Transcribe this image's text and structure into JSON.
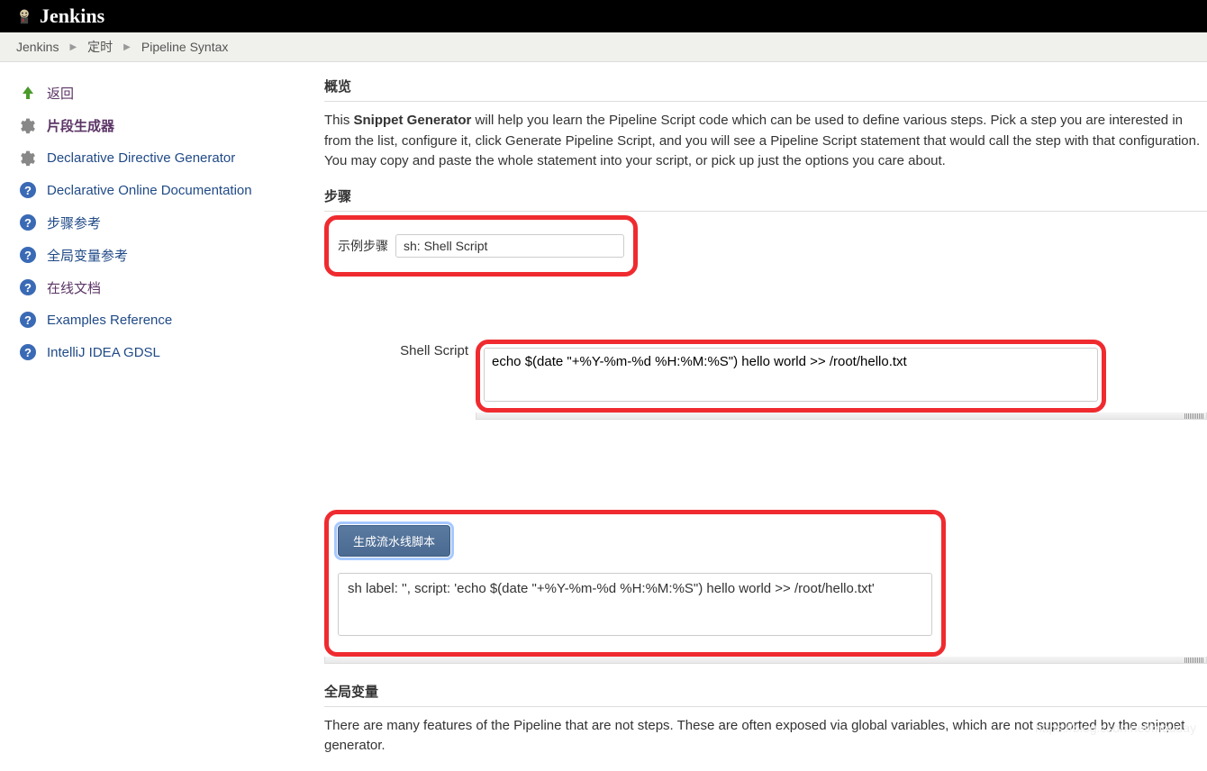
{
  "header": {
    "logo_text": "Jenkins"
  },
  "breadcrumb": [
    {
      "label": "Jenkins"
    },
    {
      "label": "定时"
    },
    {
      "label": "Pipeline Syntax"
    }
  ],
  "sidebar": {
    "items": [
      {
        "icon": "up-arrow",
        "label": "返回",
        "style": "link-purple"
      },
      {
        "icon": "gear",
        "label": "片段生成器",
        "style": "active"
      },
      {
        "icon": "gear",
        "label": "Declarative Directive Generator",
        "style": "link-blue"
      },
      {
        "icon": "help",
        "label": "Declarative Online Documentation",
        "style": "link-blue"
      },
      {
        "icon": "help",
        "label": "步骤参考",
        "style": "link-blue"
      },
      {
        "icon": "help",
        "label": "全局变量参考",
        "style": "link-blue"
      },
      {
        "icon": "help",
        "label": "在线文档",
        "style": "link-purple"
      },
      {
        "icon": "help",
        "label": "Examples Reference",
        "style": "link-blue"
      },
      {
        "icon": "help",
        "label": "IntelliJ IDEA GDSL",
        "style": "link-blue"
      }
    ]
  },
  "main": {
    "overview_title": "概览",
    "intro_prefix": "This ",
    "intro_bold": "Snippet Generator",
    "intro_rest": " will help you learn the Pipeline Script code which can be used to define various steps. Pick a step you are interested in from the list, configure it, click Generate Pipeline Script, and you will see a Pipeline Script statement that would call the step with that configuration. You may copy and paste the whole statement into your script, or pick up just the options you care about.",
    "step_section_title": "步骤",
    "step_label": "示例步骤",
    "step_value": "sh: Shell Script",
    "shell_label": "Shell Script",
    "shell_value": "echo $(date \"+%Y-%m-%d %H:%M:%S\") hello world >> /root/hello.txt",
    "generate_button": "生成流水线脚本",
    "output_value": "sh label: '', script: 'echo $(date \"+%Y-%m-%d %H:%M:%S\") hello world >> /root/hello.txt'",
    "global_title": "全局变量",
    "global_text": "There are many features of the Pipeline that are not steps. These are often exposed via global variables, which are not supported by the snippet generator."
  },
  "watermark": "https://blog.csdn.net/mouday"
}
